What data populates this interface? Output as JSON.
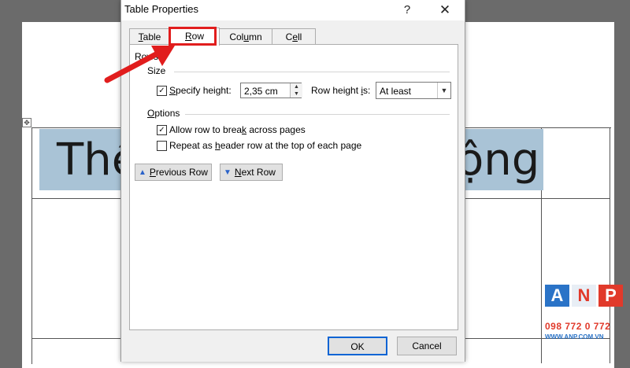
{
  "document": {
    "heading_left": "Thê",
    "heading_right": "ộng",
    "move_handle_icon": "move-icon"
  },
  "watermark": {
    "letters": [
      "A",
      "N",
      "P"
    ],
    "phone": "098 772 0 772",
    "website": "WWW.ANP.COM.VN"
  },
  "dialog": {
    "title": "Table Properties",
    "help": "?",
    "close": "✕",
    "tabs": [
      {
        "label_pre": "",
        "label_u": "T",
        "label_post": "able"
      },
      {
        "label_pre": "",
        "label_u": "R",
        "label_post": "ow"
      },
      {
        "label_pre": "Col",
        "label_u": "u",
        "label_post": "mn"
      },
      {
        "label_pre": "C",
        "label_u": "e",
        "label_post": "ll"
      }
    ],
    "active_tab": "Row",
    "row_section_label": "Rows:",
    "size_label": "Size",
    "specify_height": {
      "pre": "",
      "u": "S",
      "post": "pecify height:",
      "checked": true
    },
    "height_value": "2,35 cm",
    "row_height_is": {
      "pre": "Row height ",
      "u": "i",
      "post": "s:"
    },
    "row_height_option": "At least",
    "options_label": {
      "pre": "",
      "u": "O",
      "post": "ptions"
    },
    "allow_break": {
      "pre": "Allow row to brea",
      "u": "k",
      "post": " across pages",
      "checked": true
    },
    "repeat_header": {
      "pre": "Repeat as ",
      "u": "h",
      "post": "eader row at the top of each page",
      "checked": false
    },
    "previous_row": {
      "pre": "",
      "u": "P",
      "post": "revious Row"
    },
    "next_row": {
      "pre": "",
      "u": "N",
      "post": "ext Row"
    },
    "ok": "OK",
    "cancel": "Cancel"
  },
  "colors": {
    "highlight_red": "#e11d1d",
    "ok_border": "#0a64d4"
  }
}
